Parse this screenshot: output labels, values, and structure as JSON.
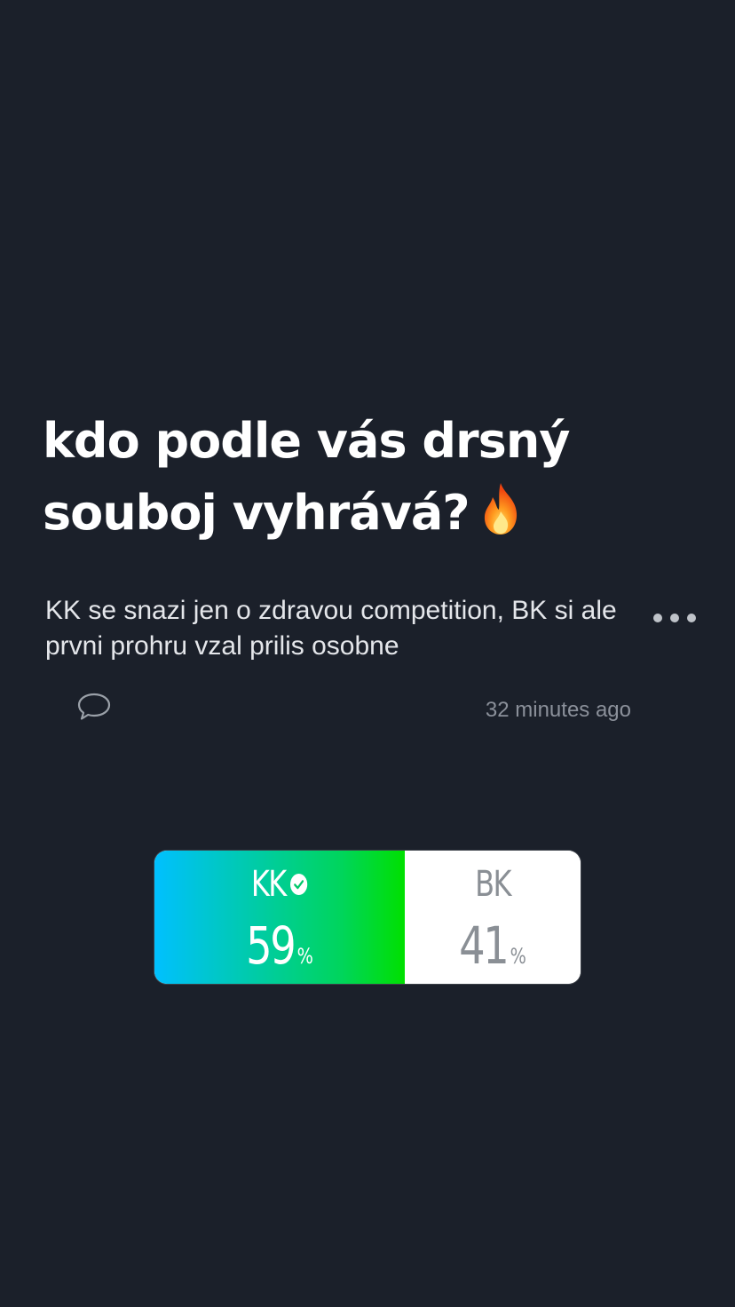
{
  "story": {
    "question_line1": "kdo podle vás drsný",
    "question_line2": "souboj vyhrává?",
    "question_emoji": "fire-emoji",
    "caption": "KK se snazi jen o zdravou competition, BK si ale prvni prohru vzal prilis osobne",
    "timestamp": "32 minutes ago",
    "icons": {
      "more": "more-dots-icon",
      "comment": "comment-bubble-icon",
      "winner_mark": "check-circle-icon"
    }
  },
  "poll": {
    "options": [
      {
        "label": "KK",
        "percent": "59",
        "percent_sign": "%",
        "share": 0.59,
        "winner": true
      },
      {
        "label": "BK",
        "percent": "41",
        "percent_sign": "%",
        "share": 0.41,
        "winner": false
      }
    ],
    "colors": {
      "winner_gradient_start": "#00c0ff",
      "winner_gradient_end": "#00e000",
      "other_background": "#ffffff",
      "other_text": "#8a8f95",
      "page_background": "#1b202a"
    }
  }
}
